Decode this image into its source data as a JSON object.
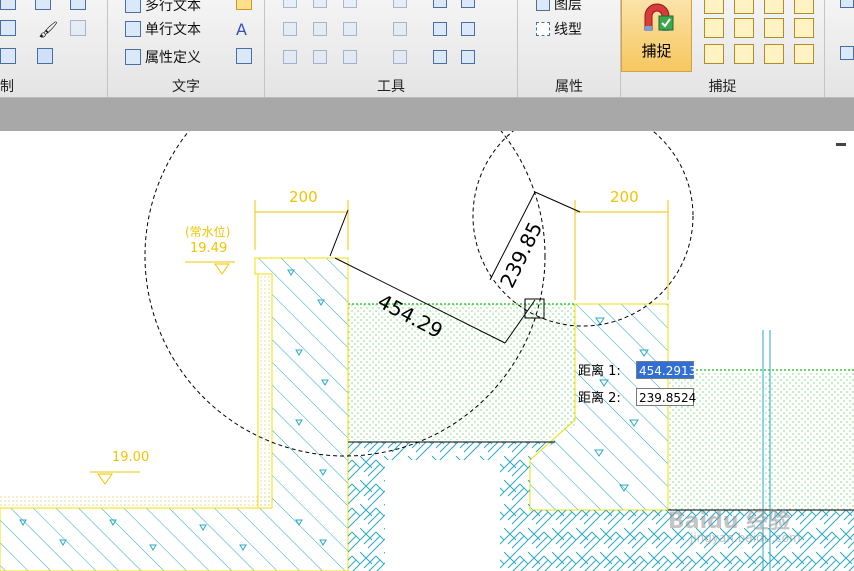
{
  "ribbon": {
    "groups": [
      {
        "label": "制"
      },
      {
        "label": "文字"
      },
      {
        "label": "工具"
      },
      {
        "label": "属性"
      },
      {
        "label": "捕捉"
      }
    ],
    "text_tools": {
      "multiline": "多行文本",
      "single_line": "单行文本",
      "attr_def": "属性定义"
    },
    "props_tools": {
      "layer": "图层",
      "linetype": "线型"
    },
    "snap_button": "捕捉"
  },
  "drawing": {
    "dim_left": "200",
    "dim_right": "200",
    "level_label": "(常水位)",
    "level_value": "19.49",
    "level_bottom": "19.00",
    "dim_diag1": "454.29",
    "dim_diag2": "239.85"
  },
  "distance_input": {
    "label1": "距离 1:",
    "value1": "454.2913",
    "label2": "距离 2:",
    "value2": "239.8524"
  },
  "watermark": "Baidu 经验",
  "watermark_url": "jingyan.baidu.com",
  "colors": {
    "dimension": "#f2c400",
    "hatch": "#2aa8c8",
    "grass": "#33cc33",
    "accent": "#2f6fd6"
  }
}
